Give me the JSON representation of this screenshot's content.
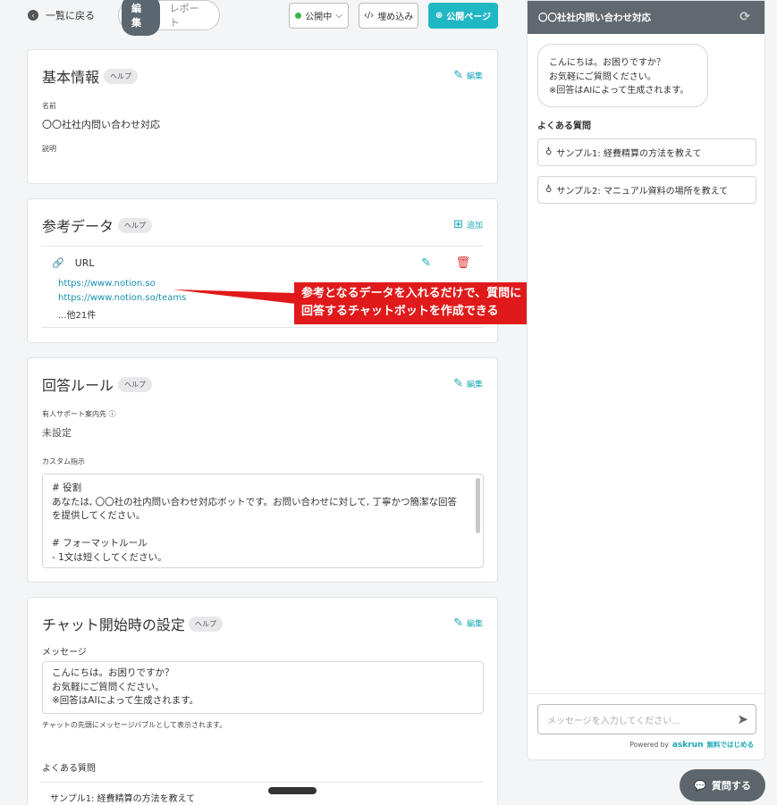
{
  "topbar": {
    "back_label": "一覧に戻る",
    "tab_edit": "編集",
    "tab_report": "レポート",
    "status_label": "公開中",
    "embed_label": "埋め込み",
    "public_page_label": "公開ページ"
  },
  "basic_info": {
    "title": "基本情報",
    "help": "ヘルプ",
    "edit": "編集",
    "name_label": "名前",
    "name_value": "〇〇社社内問い合わせ対応",
    "desc_label": "説明"
  },
  "reference": {
    "title": "参考データ",
    "help": "ヘルプ",
    "add": "追加",
    "type_label": "URL",
    "links": [
      "https://www.notion.so",
      "https://www.notion.so/teams"
    ],
    "more": "...他21件"
  },
  "annotation": {
    "line1": "参考となるデータを入れるだけで、質問に",
    "line2": "回答するチャットボットを作成できる"
  },
  "rules": {
    "title": "回答ルール",
    "help": "ヘルプ",
    "edit": "編集",
    "support_label": "有人サポート案内先",
    "support_value": "未設定",
    "custom_label": "カスタム指示",
    "custom_lines": [
      "# 役割",
      "あなたは, 〇〇社の社内問い合わせ対応ボットです。お問い合わせに対して, 丁寧かつ簡潔な回答",
      "を提供してください。",
      "",
      "# フォーマットルール",
      "- 1文は短くしてください。"
    ]
  },
  "chat_start": {
    "title": "チャット開始時の設定",
    "help": "ヘルプ",
    "edit": "編集",
    "message_label": "メッセージ",
    "message_lines": [
      "こんにちは。お困りですか？",
      "お気軽にご質問ください。",
      "※回答はAIによって生成されます。"
    ],
    "message_note": "チャットの先頭にメッセージバブルとして表示されます。",
    "faq_label": "よくある質問",
    "faq_first": "サンプル1: 経費精算の方法を教えて"
  },
  "chat": {
    "title": "〇〇社社内問い合わせ対応",
    "bubble_lines": [
      "こんにちは。お困りですか？",
      "お気軽にご質問ください。",
      "※回答はAIによって生成されます。"
    ],
    "faq_title": "よくある質問",
    "faqs": [
      "サンプル1: 経費精算の方法を教えて",
      "サンプル2: マニュアル資料の場所を教えて"
    ],
    "input_placeholder": "メッセージを入力してください...",
    "powered_by": "Powered by",
    "brand": "askrun",
    "free_start": "無料ではじめる"
  },
  "ask_button": "質問する",
  "colors": {
    "accent": "#20b7c4",
    "header": "#60696f",
    "callout": "#e01a1a"
  }
}
